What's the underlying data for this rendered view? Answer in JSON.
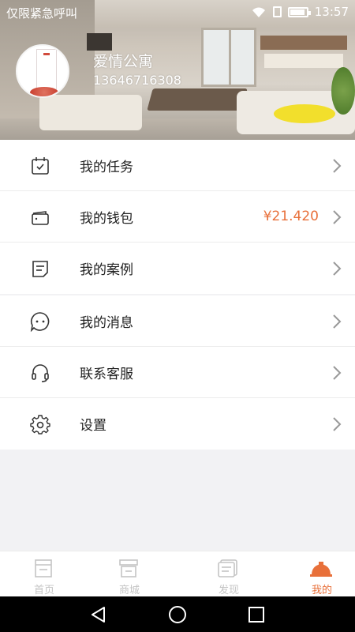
{
  "status_bar": {
    "carrier_text": "仅限紧急呼叫",
    "time": "13:57"
  },
  "profile": {
    "name": "爱情公寓",
    "phone": "13646716308"
  },
  "menu": {
    "group1": [
      {
        "label": "我的任务",
        "icon": "task-calendar-icon"
      },
      {
        "label": "我的钱包",
        "icon": "wallet-icon",
        "value": "¥21.420"
      },
      {
        "label": "我的案例",
        "icon": "case-document-icon"
      }
    ],
    "group2": [
      {
        "label": "我的消息",
        "icon": "message-bubble-icon"
      },
      {
        "label": "联系客服",
        "icon": "headset-icon"
      },
      {
        "label": "设置",
        "icon": "gear-icon"
      }
    ]
  },
  "bottom_nav": [
    {
      "label": "首页",
      "icon": "home-icon",
      "active": false
    },
    {
      "label": "商城",
      "icon": "shop-icon",
      "active": false
    },
    {
      "label": "发现",
      "icon": "discover-icon",
      "active": false
    },
    {
      "label": "我的",
      "icon": "profile-helmet-icon",
      "active": true
    }
  ],
  "colors": {
    "accent": "#e8703a",
    "inactive": "#c4c4c4",
    "background": "#f2f2f4"
  }
}
